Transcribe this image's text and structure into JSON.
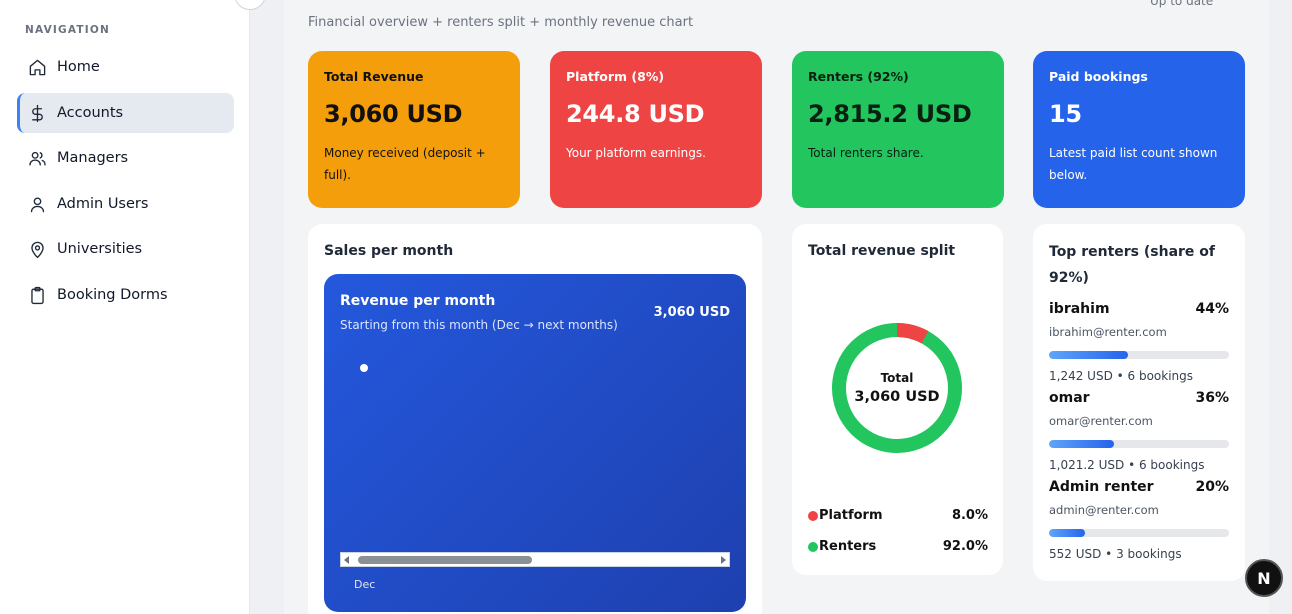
{
  "sidebar": {
    "heading": "NAVIGATION",
    "items": [
      {
        "label": "Home",
        "icon": "home-icon"
      },
      {
        "label": "Accounts",
        "icon": "dollar-icon",
        "active": true
      },
      {
        "label": "Managers",
        "icon": "users-icon"
      },
      {
        "label": "Admin Users",
        "icon": "user-icon"
      },
      {
        "label": "Universities",
        "icon": "map-pin-icon"
      },
      {
        "label": "Booking Dorms",
        "icon": "clipboard-icon"
      }
    ]
  },
  "header": {
    "subtitle": "Financial overview + renters split + monthly revenue chart",
    "status": "Up to date"
  },
  "stats": [
    {
      "title": "Total Revenue",
      "value": "3,060 USD",
      "desc": "Money received (deposit + full).",
      "color": "#f59e0b"
    },
    {
      "title": "Platform (8%)",
      "value": "244.8 USD",
      "desc": "Your platform earnings.",
      "color": "#ef4444"
    },
    {
      "title": "Renters (92%)",
      "value": "2,815.2 USD",
      "desc": "Total renters share.",
      "color": "#22c55e"
    },
    {
      "title": "Paid bookings",
      "value": "15",
      "desc": "Latest paid list count shown below.",
      "color": "#2563eb"
    }
  ],
  "sales": {
    "title": "Sales per month",
    "card_title": "Revenue per month",
    "card_subtitle": "Starting from this month (Dec → next months)",
    "card_total": "3,060 USD"
  },
  "chart_data": {
    "type": "line",
    "categories": [
      "Dec"
    ],
    "values": [
      3060
    ],
    "title": "Revenue per month",
    "subtitle": "Starting from this month (Dec → next months)"
  },
  "split": {
    "title": "Total revenue split",
    "center_label": "Total",
    "center_value": "3,060 USD",
    "segments": [
      {
        "name": "Platform",
        "pct": "8.0%",
        "value": 8.0,
        "color": "#ef4444"
      },
      {
        "name": "Renters",
        "pct": "92.0%",
        "value": 92.0,
        "color": "#22c55e"
      }
    ]
  },
  "top_renters": {
    "title": "Top renters (share of 92%)",
    "items": [
      {
        "name": "ibrahim",
        "pct": "44%",
        "share": 0.44,
        "email": "ibrahim@renter.com",
        "meta": "1,242 USD • 6 bookings"
      },
      {
        "name": "omar",
        "pct": "36%",
        "share": 0.36,
        "email": "omar@renter.com",
        "meta": "1,021.2 USD • 6 bookings"
      },
      {
        "name": "Admin renter",
        "pct": "20%",
        "share": 0.2,
        "email": "admin@renter.com",
        "meta": "552 USD • 3 bookings"
      }
    ]
  },
  "badge": {
    "label": "N"
  }
}
